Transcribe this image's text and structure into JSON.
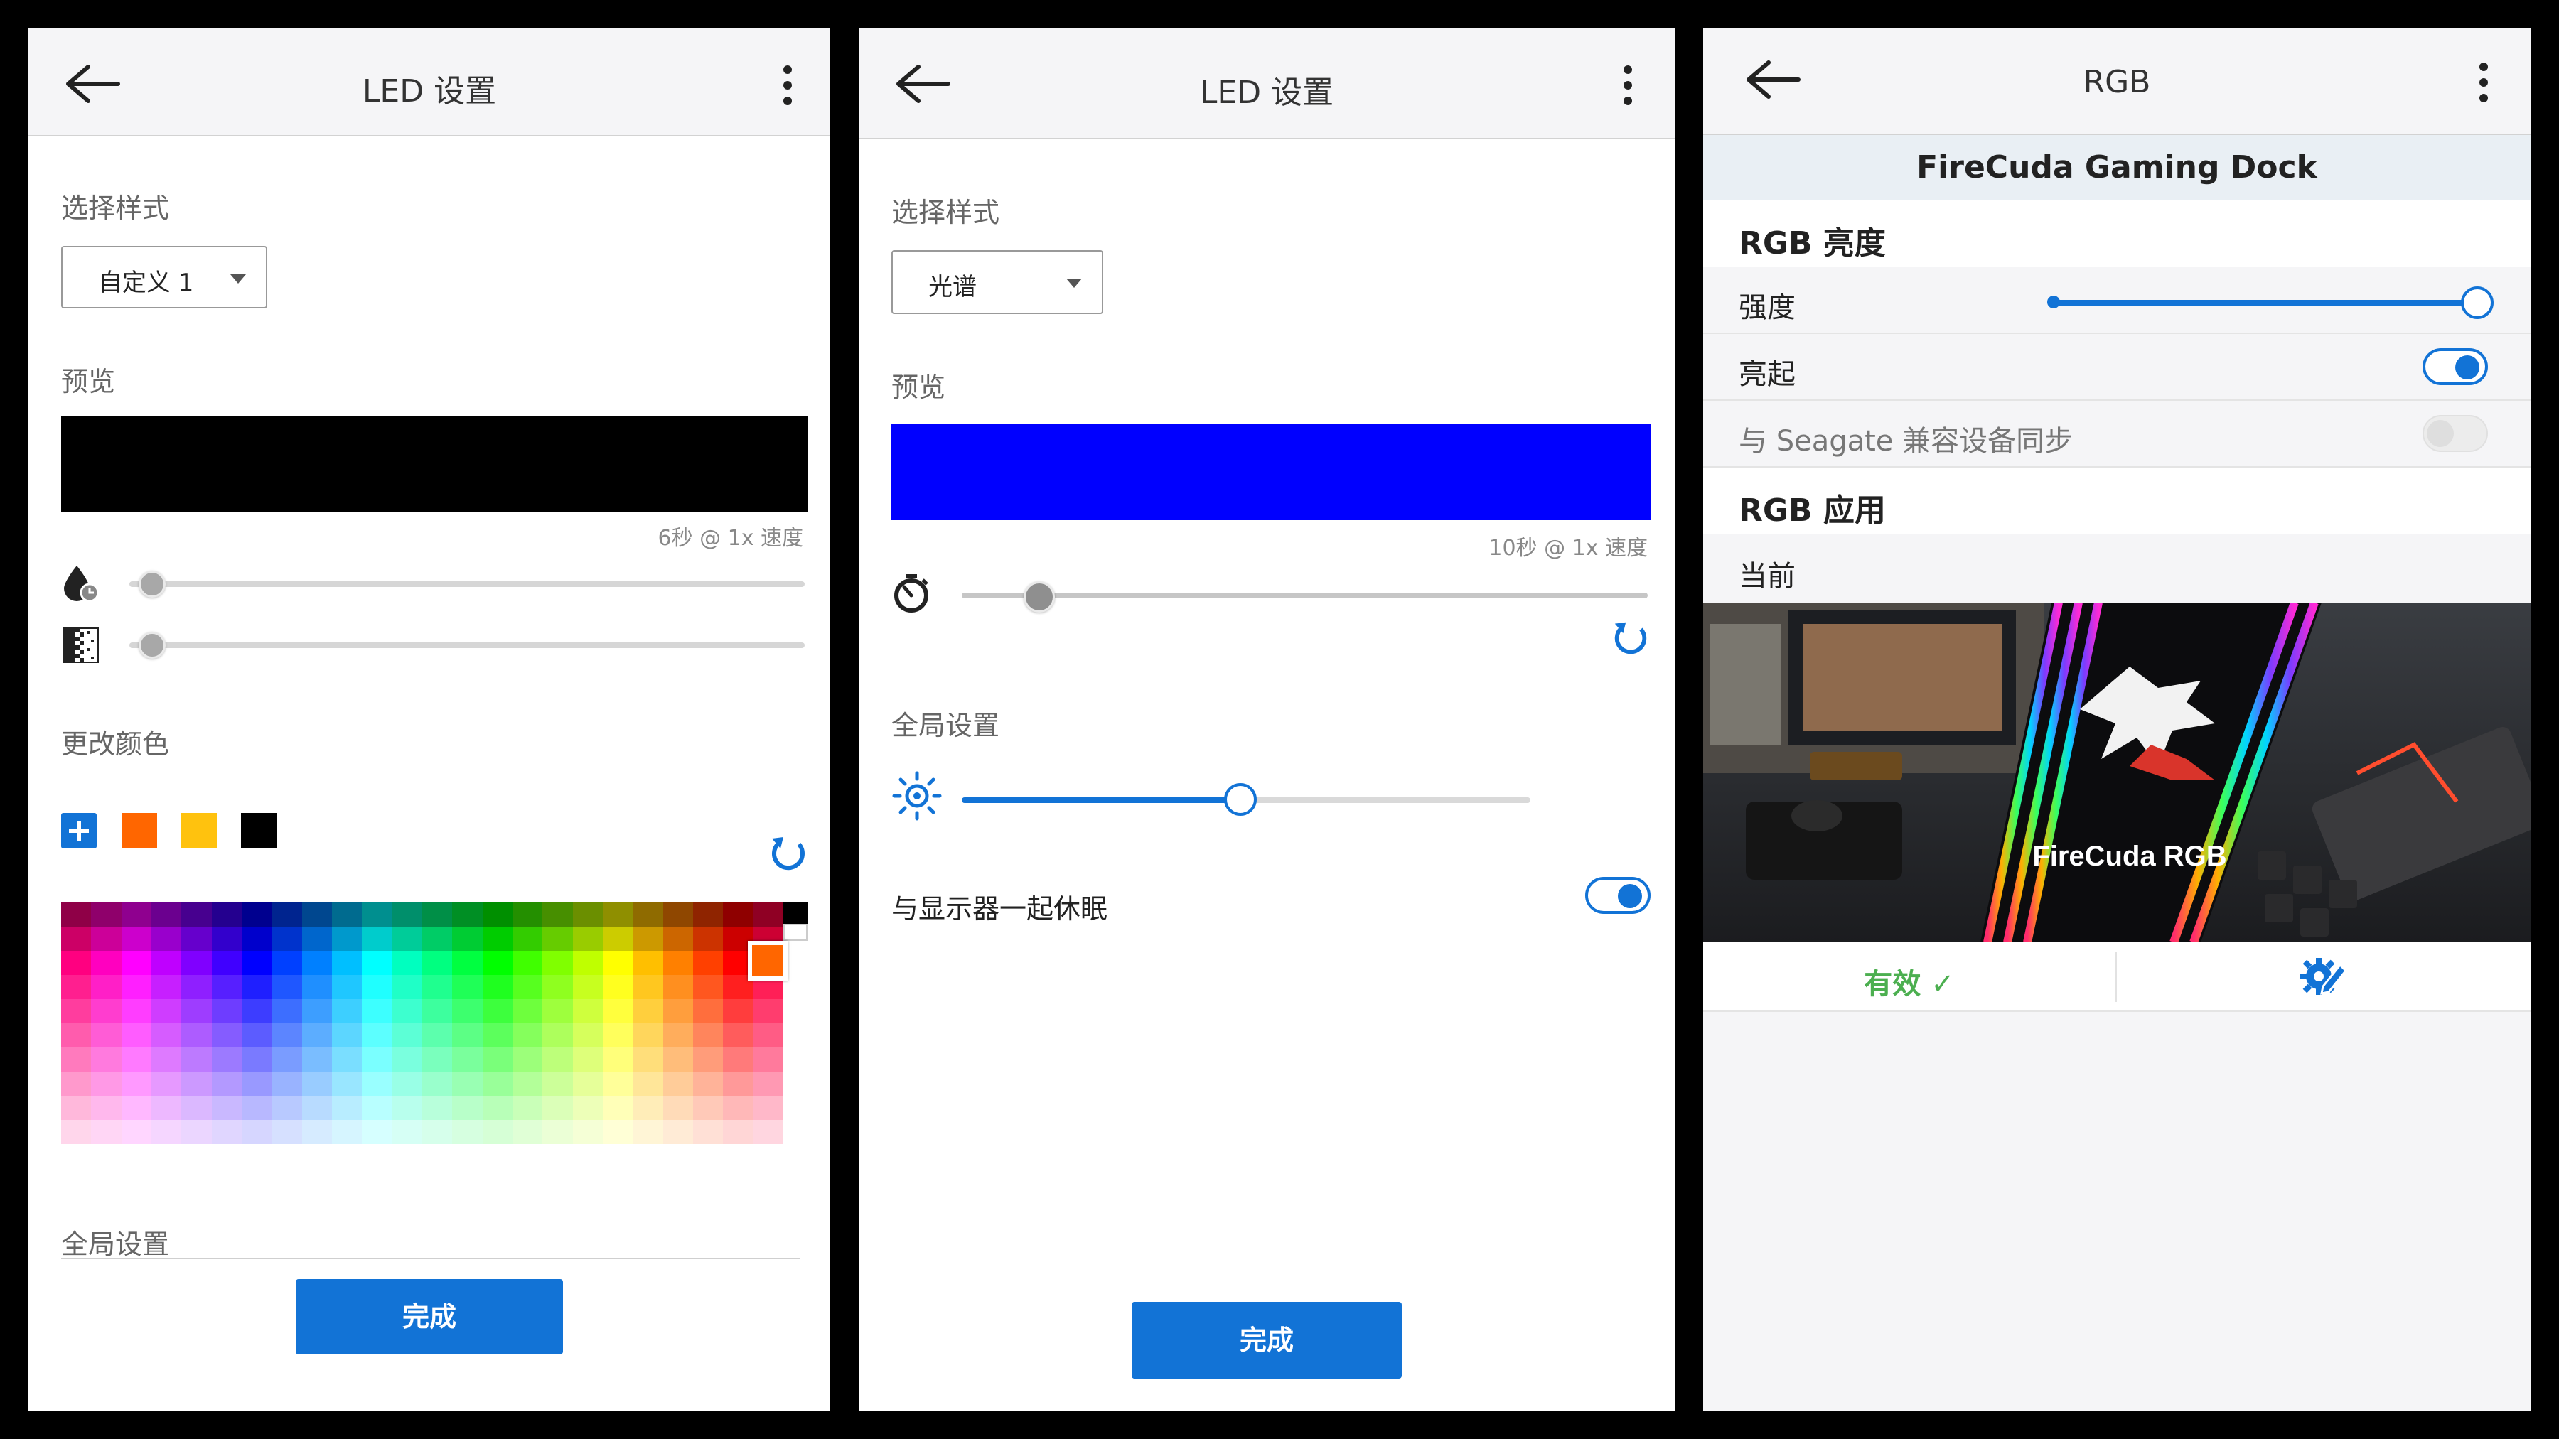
{
  "panel1": {
    "title": "LED 设置",
    "style_label": "选择样式",
    "style_value": "自定义 1",
    "preview_label": "预览",
    "preview_color": "#000000",
    "speed_text": "6秒 @ 1x 速度",
    "slider_1_icon": "drop-timer-icon",
    "slider_2_icon": "gradient-icon",
    "change_color_label": "更改颜色",
    "swatches": [
      "#ff6600",
      "#ffc20e",
      "#000000"
    ],
    "selected_color": "#ff6600",
    "global_label": "全局设置",
    "done_label": "完成"
  },
  "panel2": {
    "title": "LED 设置",
    "style_label": "选择样式",
    "style_value": "光谱",
    "preview_label": "预览",
    "preview_color": "#0000ff",
    "speed_text": "10秒 @ 1x 速度",
    "timer_icon": "stopwatch-icon",
    "global_label": "全局设置",
    "brightness_icon": "sun-icon",
    "sleep_label": "与显示器一起休眠",
    "sleep_on": true,
    "done_label": "完成"
  },
  "panel3": {
    "title": "RGB",
    "device_name": "FireCuda Gaming Dock",
    "brightness_section": "RGB 亮度",
    "intensity_label": "强度",
    "light_on_label": "亮起",
    "light_on": true,
    "sync_label": "与 Seagate 兼容设备同步",
    "sync_on": false,
    "apps_section": "RGB 应用",
    "current_label": "当前",
    "banner_text": "FireCuda RGB",
    "valid_label": "有效 ✓",
    "settings_icon": "gear-pencil-icon"
  },
  "colors": {
    "accent": "#1273d6",
    "valid_green": "#4caf50"
  }
}
